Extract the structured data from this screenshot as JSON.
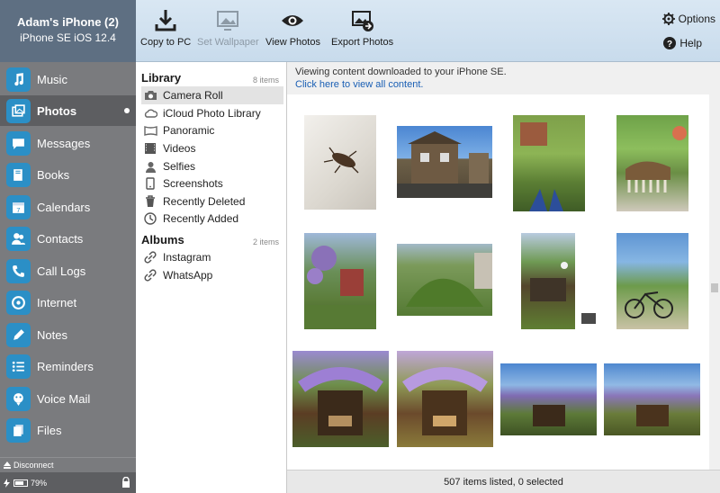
{
  "device": {
    "name": "Adam's iPhone (2)",
    "model": "iPhone SE iOS 12.4",
    "disconnect_label": "Disconnect",
    "battery": "79%",
    "battery_level": 0.79
  },
  "nav": [
    {
      "label": "Music",
      "icon": "music-note-icon"
    },
    {
      "label": "Photos",
      "icon": "photos-icon",
      "active": true
    },
    {
      "label": "Messages",
      "icon": "speech-bubble-icon"
    },
    {
      "label": "Books",
      "icon": "book-icon"
    },
    {
      "label": "Calendars",
      "icon": "calendar-icon"
    },
    {
      "label": "Contacts",
      "icon": "contacts-icon"
    },
    {
      "label": "Call Logs",
      "icon": "phone-icon"
    },
    {
      "label": "Internet",
      "icon": "internet-icon"
    },
    {
      "label": "Notes",
      "icon": "pencil-icon"
    },
    {
      "label": "Reminders",
      "icon": "list-icon"
    },
    {
      "label": "Voice Mail",
      "icon": "voicemail-icon"
    },
    {
      "label": "Files",
      "icon": "files-icon"
    }
  ],
  "toolbar": {
    "copy_to_pc": "Copy to PC",
    "set_wallpaper": "Set Wallpaper",
    "view_photos": "View Photos",
    "export_photos": "Export Photos",
    "options": "Options",
    "help": "Help"
  },
  "library": {
    "heading": "Library",
    "count": "8 items",
    "items": [
      "Camera Roll",
      "iCloud Photo Library",
      "Panoramic",
      "Videos",
      "Selfies",
      "Screenshots",
      "Recently Deleted",
      "Recently Added"
    ]
  },
  "albums": {
    "heading": "Albums",
    "count": "2 items",
    "items": [
      "Instagram",
      "WhatsApp"
    ]
  },
  "content": {
    "info_text": "Viewing content downloaded to your iPhone SE.",
    "info_link": "Click here to view all content.",
    "status": "507 items listed, 0 selected"
  },
  "colors": {
    "accent": "#2b8fc6",
    "sidebar": "#7a7b7e",
    "toolbar": "#d3e3f1",
    "link": "#1a5fb4"
  }
}
